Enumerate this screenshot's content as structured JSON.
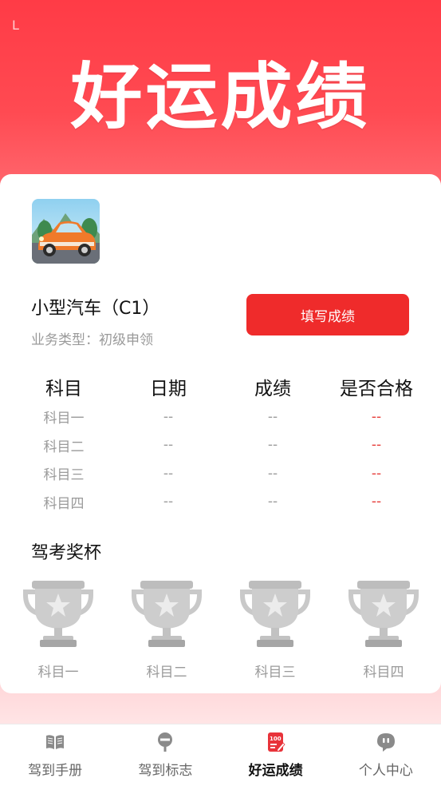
{
  "status": {
    "indicator": "L"
  },
  "hero": {
    "title": "好运成绩"
  },
  "vehicle": {
    "name": "小型汽车（C1）",
    "business_type": "业务类型：初级申领",
    "fill_button_label": "填写成绩"
  },
  "score_table": {
    "headers": [
      "科目",
      "日期",
      "成绩",
      "是否合格"
    ],
    "rows": [
      [
        "科目一",
        "--",
        "--",
        "--"
      ],
      [
        "科目二",
        "--",
        "--",
        "--"
      ],
      [
        "科目三",
        "--",
        "--",
        "--"
      ],
      [
        "科目四",
        "--",
        "--",
        "--"
      ]
    ]
  },
  "trophies": {
    "title": "驾考奖杯",
    "items": [
      {
        "label": "科目一",
        "icon": "trophy-icon"
      },
      {
        "label": "科目二",
        "icon": "trophy-icon"
      },
      {
        "label": "科目三",
        "icon": "trophy-icon"
      },
      {
        "label": "科目四",
        "icon": "trophy-icon"
      }
    ]
  },
  "tabbar": {
    "items": [
      {
        "label": "驾到手册",
        "icon": "book-icon",
        "active": false
      },
      {
        "label": "驾到标志",
        "icon": "sign-icon",
        "active": false
      },
      {
        "label": "好运成绩",
        "icon": "scorecard-icon",
        "active": true
      },
      {
        "label": "个人中心",
        "icon": "chat-person-icon",
        "active": false
      }
    ]
  },
  "colors": {
    "accent": "#ef2b2b",
    "fail_dash": "#e53935",
    "muted_text": "#9a9a9a"
  }
}
